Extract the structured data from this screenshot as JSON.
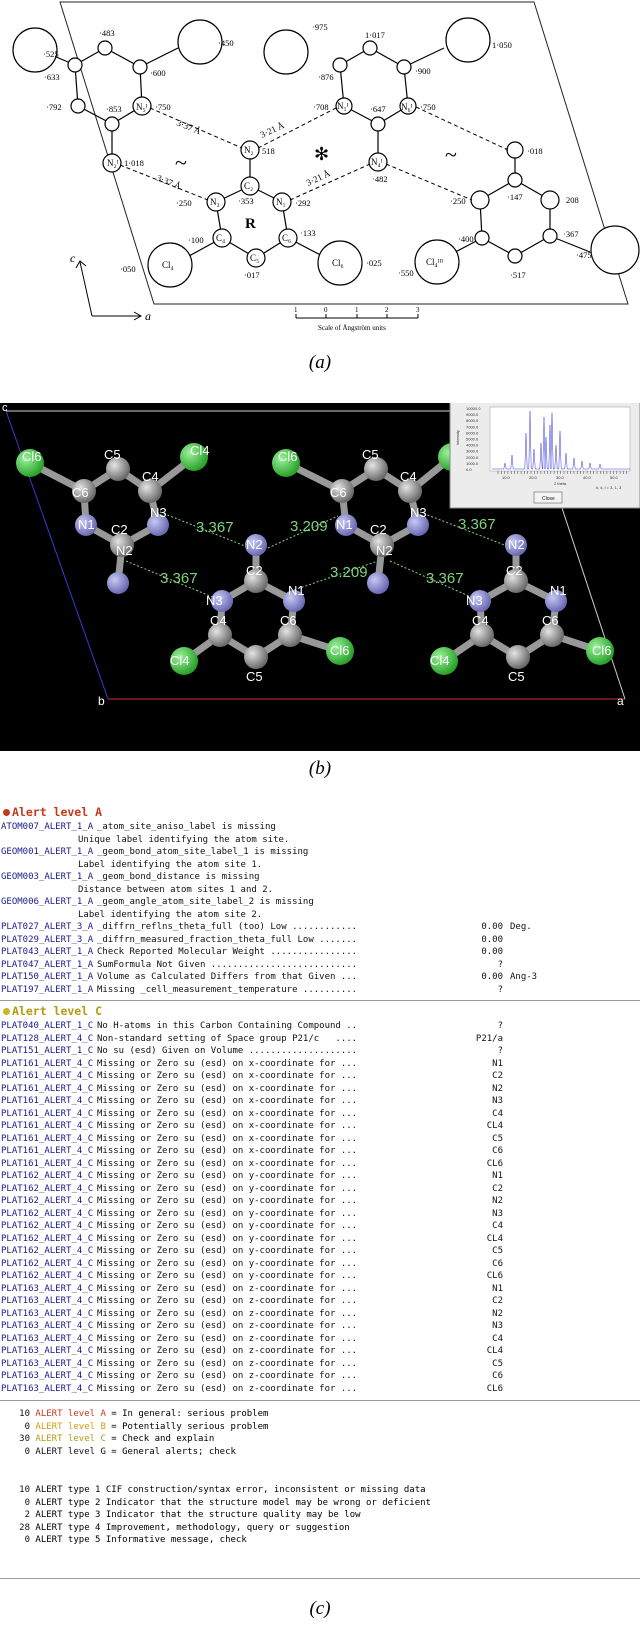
{
  "panel_a": {
    "caption": "(a)",
    "labels": {
      "n5": "N₅ᴵ",
      "n6": "N₆ᴵ",
      "n2p": "N₂ᴵ",
      "n4p": "N₄ᴵ",
      "n1p": "N₁ᴵ",
      "n2": "N₂",
      "n3": "N₃",
      "n1": "N₁",
      "c2": "C₂",
      "c4": "C₄",
      "c5": "C₅",
      "c6": "C₆",
      "cl4": "Cl₄",
      "cl6": "Cl₆",
      "cl4b": "Cl₄ᴵᴵᴵ",
      "ring": "R",
      "axis_c": "c",
      "axis_a": "a",
      "d1": "3·37 Å",
      "d2": "3·21 Å",
      "d3": "3·37 Å",
      "d4": "3·21 Å",
      "scale": "Scale of Ångström units",
      "scale_ticks": [
        "1",
        "0",
        "1",
        "2",
        "3"
      ]
    },
    "numbers": {
      "v483": "·483",
      "v525": "·525",
      "v633": "·633",
      "v600": "·600",
      "v450": "·450",
      "v792": "·792",
      "v853": "·853",
      "v750a": "·750",
      "v1018a": "1·018",
      "v975": "·975",
      "v1017": "1·017",
      "v1050": "1·050",
      "v876": "·876",
      "v900": "·900",
      "v708": "·708",
      "v647": "·647",
      "v750b": "·750",
      "v518": "518",
      "v353": "·353",
      "v292": "·292",
      "v482": "·482",
      "v018": "·018",
      "v250a": "·250",
      "v250b": "·250",
      "v147": "·147",
      "v208": "208",
      "v100": "·100",
      "v133": "·133",
      "v367": "·367",
      "v400": "·400",
      "v050": "·050",
      "v017": "·017",
      "v025": "·025",
      "v550": "·550",
      "v517": "·517",
      "v475": "·475"
    }
  },
  "panel_b": {
    "caption": "(b)",
    "cell_labels": {
      "c": "c",
      "b": "b",
      "a": "a"
    },
    "atoms": {
      "cl6_l": "Cl6",
      "c5_l": "C5",
      "c4_l": "C4",
      "c6_l": "C6",
      "n1_l": "N1",
      "c2_l": "C2",
      "n3_l": "N3",
      "n2_l": "N2",
      "cl6_m": "Cl6",
      "c5_m": "C5",
      "c4_m": "C4",
      "c6_m": "C6",
      "n1_m": "N1",
      "c2_m": "C2",
      "n3_m": "N3",
      "n2_m": "N2",
      "n2_c": "N2",
      "c2_c": "C2",
      "n3_c": "N3",
      "n1_c": "N1",
      "c4_c": "C4",
      "c6_c": "C6",
      "cl4_c": "Cl4",
      "c5_c": "C5",
      "cl6_c": "Cl6",
      "n2_r": "N2",
      "c2_r": "C2",
      "n3_r": "N3",
      "n1_r": "N1",
      "c4_r": "C4",
      "c6_r": "C6",
      "cl4_r": "Cl4",
      "c5_r": "C5",
      "cl6_r": "Cl6",
      "cl4_l": "Cl4"
    },
    "distances": {
      "d1": "3.367",
      "d2": "3.209",
      "d3": "3.367",
      "d4": "3.367",
      "d5": "3.209",
      "d6": "3.367"
    },
    "inset": {
      "xlabel": "2 theta",
      "ylabel": "Intensity",
      "hkl": "h, k, l = 3, 1, 3",
      "button": "Close",
      "yticks": [
        "10000.0",
        "9000.0",
        "8000.0",
        "7000.0",
        "6000.0",
        "5000.0",
        "4000.0",
        "3000.0",
        "2000.0",
        "1000.0",
        "0.0"
      ],
      "xticks": [
        "10.0",
        "20.0",
        "30.0",
        "40.0",
        "50.0"
      ]
    }
  },
  "panel_c": {
    "caption": "(c)",
    "level_a": {
      "title": "Alert level A",
      "rows": [
        {
          "code": "ATOM007_ALERT_1_A",
          "msg": "_atom_site_aniso_label is missing",
          "val": "",
          "unit": ""
        },
        {
          "code": "",
          "desc": "Unique label identifying the atom site.",
          "val": "",
          "unit": ""
        },
        {
          "code": "GEOM001_ALERT_1_A",
          "msg": "_geom_bond_atom_site_label_1 is missing",
          "val": "",
          "unit": ""
        },
        {
          "code": "",
          "desc": "Label identifying the atom site 1.",
          "val": "",
          "unit": ""
        },
        {
          "code": "GEOM003_ALERT_1_A",
          "msg": "_geom_bond_distance is missing",
          "val": "",
          "unit": ""
        },
        {
          "code": "",
          "desc": "Distance between atom sites 1 and 2.",
          "val": "",
          "unit": ""
        },
        {
          "code": "GEOM006_ALERT_1_A",
          "msg": "_geom_angle_atom_site_label_2 is missing",
          "val": "",
          "unit": ""
        },
        {
          "code": "",
          "desc": "Label identifying the atom site 2.",
          "val": "",
          "unit": ""
        },
        {
          "code": "PLAT027_ALERT_3_A",
          "msg": "_diffrn_reflns_theta_full (too) Low ............",
          "val": "0.00",
          "unit": "Deg."
        },
        {
          "code": "PLAT029_ALERT_3_A",
          "msg": "_diffrn_measured_fraction_theta_full Low .......",
          "val": "0.00",
          "unit": ""
        },
        {
          "code": "PLAT043_ALERT_1_A",
          "msg": "Check Reported Molecular Weight ................",
          "val": "0.00",
          "unit": ""
        },
        {
          "code": "PLAT047_ALERT_1_A",
          "msg": "SumFormula Not Given ...........................",
          "val": "?",
          "unit": ""
        },
        {
          "code": "PLAT150_ALERT_1_A",
          "msg": "Volume as Calculated Differs from that Given ...",
          "val": "0.00",
          "unit": "Ang-3"
        },
        {
          "code": "PLAT197_ALERT_1_A",
          "msg": "Missing _cell_measurement_temperature ..........",
          "val": "?",
          "unit": ""
        }
      ]
    },
    "level_c": {
      "title": "Alert level C",
      "rows": [
        {
          "code": "PLAT040_ALERT_1_C",
          "msg": "No H-atoms in this Carbon Containing Compound ..",
          "val": "?",
          "unit": ""
        },
        {
          "code": "PLAT128_ALERT_4_C",
          "msg": "Non-standard setting of Space group P21/c   ....",
          "val": "P21/a",
          "unit": ""
        },
        {
          "code": "PLAT151_ALERT_1_C",
          "msg": "No su (esd) Given on Volume ....................",
          "val": "?",
          "unit": ""
        },
        {
          "code": "PLAT161_ALERT_4_C",
          "msg": "Missing or Zero su (esd) on x-coordinate for ...",
          "val": "N1",
          "unit": ""
        },
        {
          "code": "PLAT161_ALERT_4_C",
          "msg": "Missing or Zero su (esd) on x-coordinate for ...",
          "val": "C2",
          "unit": ""
        },
        {
          "code": "PLAT161_ALERT_4_C",
          "msg": "Missing or Zero su (esd) on x-coordinate for ...",
          "val": "N2",
          "unit": ""
        },
        {
          "code": "PLAT161_ALERT_4_C",
          "msg": "Missing or Zero su (esd) on x-coordinate for ...",
          "val": "N3",
          "unit": ""
        },
        {
          "code": "PLAT161_ALERT_4_C",
          "msg": "Missing or Zero su (esd) on x-coordinate for ...",
          "val": "C4",
          "unit": ""
        },
        {
          "code": "PLAT161_ALERT_4_C",
          "msg": "Missing or Zero su (esd) on x-coordinate for ...",
          "val": "CL4",
          "unit": ""
        },
        {
          "code": "PLAT161_ALERT_4_C",
          "msg": "Missing or Zero su (esd) on x-coordinate for ...",
          "val": "C5",
          "unit": ""
        },
        {
          "code": "PLAT161_ALERT_4_C",
          "msg": "Missing or Zero su (esd) on x-coordinate for ...",
          "val": "C6",
          "unit": ""
        },
        {
          "code": "PLAT161_ALERT_4_C",
          "msg": "Missing or Zero su (esd) on x-coordinate for ...",
          "val": "CL6",
          "unit": ""
        },
        {
          "code": "PLAT162_ALERT_4_C",
          "msg": "Missing or Zero su (esd) on y-coordinate for ...",
          "val": "N1",
          "unit": ""
        },
        {
          "code": "PLAT162_ALERT_4_C",
          "msg": "Missing or Zero su (esd) on y-coordinate for ...",
          "val": "C2",
          "unit": ""
        },
        {
          "code": "PLAT162_ALERT_4_C",
          "msg": "Missing or Zero su (esd) on y-coordinate for ...",
          "val": "N2",
          "unit": ""
        },
        {
          "code": "PLAT162_ALERT_4_C",
          "msg": "Missing or Zero su (esd) on y-coordinate for ...",
          "val": "N3",
          "unit": ""
        },
        {
          "code": "PLAT162_ALERT_4_C",
          "msg": "Missing or Zero su (esd) on y-coordinate for ...",
          "val": "C4",
          "unit": ""
        },
        {
          "code": "PLAT162_ALERT_4_C",
          "msg": "Missing or Zero su (esd) on y-coordinate for ...",
          "val": "CL4",
          "unit": ""
        },
        {
          "code": "PLAT162_ALERT_4_C",
          "msg": "Missing or Zero su (esd) on y-coordinate for ...",
          "val": "C5",
          "unit": ""
        },
        {
          "code": "PLAT162_ALERT_4_C",
          "msg": "Missing or Zero su (esd) on y-coordinate for ...",
          "val": "C6",
          "unit": ""
        },
        {
          "code": "PLAT162_ALERT_4_C",
          "msg": "Missing or Zero su (esd) on y-coordinate for ...",
          "val": "CL6",
          "unit": ""
        },
        {
          "code": "PLAT163_ALERT_4_C",
          "msg": "Missing or Zero su (esd) on z-coordinate for ...",
          "val": "N1",
          "unit": ""
        },
        {
          "code": "PLAT163_ALERT_4_C",
          "msg": "Missing or Zero su (esd) on z-coordinate for ...",
          "val": "C2",
          "unit": ""
        },
        {
          "code": "PLAT163_ALERT_4_C",
          "msg": "Missing or Zero su (esd) on z-coordinate for ...",
          "val": "N2",
          "unit": ""
        },
        {
          "code": "PLAT163_ALERT_4_C",
          "msg": "Missing or Zero su (esd) on z-coordinate for ...",
          "val": "N3",
          "unit": ""
        },
        {
          "code": "PLAT163_ALERT_4_C",
          "msg": "Missing or Zero su (esd) on z-coordinate for ...",
          "val": "C4",
          "unit": ""
        },
        {
          "code": "PLAT163_ALERT_4_C",
          "msg": "Missing or Zero su (esd) on z-coordinate for ...",
          "val": "CL4",
          "unit": ""
        },
        {
          "code": "PLAT163_ALERT_4_C",
          "msg": "Missing or Zero su (esd) on z-coordinate for ...",
          "val": "C5",
          "unit": ""
        },
        {
          "code": "PLAT163_ALERT_4_C",
          "msg": "Missing or Zero su (esd) on z-coordinate for ...",
          "val": "C6",
          "unit": ""
        },
        {
          "code": "PLAT163_ALERT_4_C",
          "msg": "Missing or Zero su (esd) on z-coordinate for ...",
          "val": "CL6",
          "unit": ""
        }
      ]
    },
    "summary_levels": [
      {
        "n": "10",
        "lvl": "ALERT level A",
        "cls": "lvl",
        "text": " = In general: serious problem"
      },
      {
        "n": "0",
        "lvl": "ALERT level B",
        "cls": "lvlB",
        "text": " = Potentially serious problem"
      },
      {
        "n": "30",
        "lvl": "ALERT level C",
        "cls": "lvlC",
        "text": " = Check and explain"
      },
      {
        "n": "0",
        "lvl": "ALERT level G",
        "cls": "lvlG",
        "text": " = General alerts; check"
      }
    ],
    "summary_types": [
      {
        "n": "10",
        "text": "ALERT type 1 CIF construction/syntax error, inconsistent or missing data"
      },
      {
        "n": "0",
        "text": "ALERT type 2 Indicator that the structure model may be wrong or deficient"
      },
      {
        "n": "2",
        "text": "ALERT type 3 Indicator that the structure quality may be low"
      },
      {
        "n": "28",
        "text": "ALERT type 4 Improvement, methodology, query or suggestion"
      },
      {
        "n": "0",
        "text": "ALERT type 5 Informative message, check"
      }
    ],
    "colors": {
      "level_a": "#c53a1d",
      "level_b": "#d79a10",
      "level_c": "#b59a10",
      "code": "#1a1a8c"
    }
  }
}
